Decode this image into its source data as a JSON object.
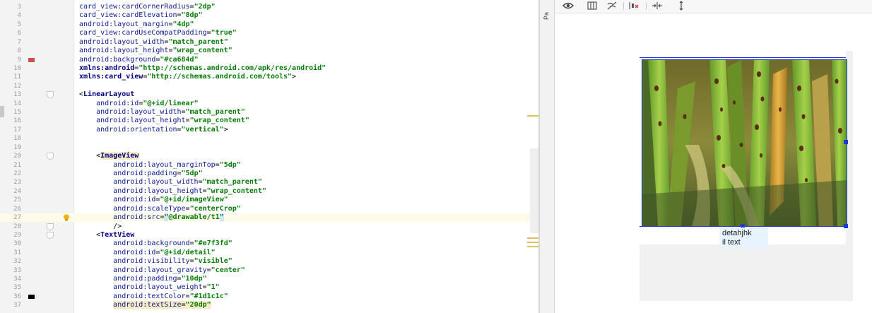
{
  "editor": {
    "lines": [
      {
        "n": "3",
        "html": "<span class=\"ns\">card_view:cardCornerRadius</span>=<span class=\"val\">\"2dp\"</span>"
      },
      {
        "n": "4",
        "html": "<span class=\"ns\">card_view:cardElevation</span>=<span class=\"val\">\"8dp\"</span>"
      },
      {
        "n": "5",
        "html": "<span class=\"attr\">android:layout_margin</span>=<span class=\"val\">\"4dp\"</span>"
      },
      {
        "n": "6",
        "html": "<span class=\"ns\">card_view:cardUseCompatPadding</span>=<span class=\"val\">\"true\"</span>"
      },
      {
        "n": "7",
        "html": "<span class=\"attr\">android:layout_width</span>=<span class=\"val\">\"match_parent\"</span>"
      },
      {
        "n": "8",
        "html": "<span class=\"attr\">android:layout_height</span>=<span class=\"val\">\"wrap_content\"</span>"
      },
      {
        "n": "9",
        "html": "<span class=\"attr\">android:background</span>=<span class=\"val\">\"#ca684d\"</span>",
        "mark": "red"
      },
      {
        "n": "10",
        "html": "<span class=\"tag\">xmlns:android</span>=<span class=\"val\">\"http://schemas.android.com/apk/res/android\"</span>"
      },
      {
        "n": "11",
        "html": "<span class=\"tag\">xmlns:card_view</span>=<span class=\"val\">\"http://schemas.android.com/tools\"</span>&gt;"
      },
      {
        "n": "12",
        "html": ""
      },
      {
        "n": "13",
        "html": "&lt;<span class=\"tag\">LinearLayout</span>",
        "fold": true
      },
      {
        "n": "14",
        "html": "    <span class=\"attr\">android:id</span>=<span class=\"val\">\"@+id/linear\"</span>"
      },
      {
        "n": "15",
        "html": "    <span class=\"attr\">android:layout_width</span>=<span class=\"val\">\"match_parent\"</span>"
      },
      {
        "n": "16",
        "html": "    <span class=\"attr\">android:layout_height</span>=<span class=\"val\">\"wrap_content\"</span>"
      },
      {
        "n": "17",
        "html": "    <span class=\"attr\">android:orientation</span>=<span class=\"val\">\"vertical\"</span>&gt;"
      },
      {
        "n": "18",
        "html": ""
      },
      {
        "n": "19",
        "html": ""
      },
      {
        "n": "20",
        "html": "    &lt;<span class=\"tag hl\">ImageView</span>",
        "fold": true
      },
      {
        "n": "21",
        "html": "        <span class=\"attr\">android:layout_marginTop</span>=<span class=\"val\">\"5dp\"</span>"
      },
      {
        "n": "22",
        "html": "        <span class=\"attr\">android:padding</span>=<span class=\"val\">\"5dp\"</span>"
      },
      {
        "n": "23",
        "html": "        <span class=\"attr\">android:layout_width</span>=<span class=\"val\">\"match_parent\"</span>"
      },
      {
        "n": "24",
        "html": "        <span class=\"attr\">android:layout_height</span>=<span class=\"val\">\"wrap_content\"</span>"
      },
      {
        "n": "25",
        "html": "        <span class=\"attr\">android:id</span>=<span class=\"val\">\"@+id/imageView\"</span>"
      },
      {
        "n": "26",
        "html": "        <span class=\"attr\">android:scaleType</span>=<span class=\"val\">\"centerCrop\"</span>"
      },
      {
        "n": "27",
        "html": "        <span class=\"attr\">android:src</span>=<span class=\"val\"><span class=\"sel\">\"</span>@drawable/t1<span class=\"sel\">\"</span></span>",
        "current": true,
        "bulb": true
      },
      {
        "n": "28",
        "html": "        /&gt;",
        "fold": true
      },
      {
        "n": "29",
        "html": "    &lt;<span class=\"tag\">TextView</span>",
        "fold": true
      },
      {
        "n": "30",
        "html": "        <span class=\"attr\">android:background</span>=<span class=\"val\">\"#e7f3fd\"</span>"
      },
      {
        "n": "31",
        "html": "        <span class=\"attr\">android:id</span>=<span class=\"val\">\"@+id/detail\"</span>"
      },
      {
        "n": "32",
        "html": "        <span class=\"attr\">android:visibility</span>=<span class=\"val\">\"visible\"</span>"
      },
      {
        "n": "33",
        "html": "        <span class=\"attr\">android:layout_gravity</span>=<span class=\"val\">\"center\"</span>"
      },
      {
        "n": "34",
        "html": "        <span class=\"attr\">android:padding</span>=<span class=\"val\">\"10dp\"</span>"
      },
      {
        "n": "35",
        "html": "        <span class=\"attr\">android:layout_weight</span>=<span class=\"val\">\"1\"</span>"
      },
      {
        "n": "36",
        "html": "        <span class=\"attr\">android:textColor</span>=<span class=\"val\">\"#1d1c1c\"</span>",
        "mark": "black"
      },
      {
        "n": "37",
        "html": "        <span class=\"attr hl\">android:textSize</span><span class=\"hl\">=</span><span class=\"val hl\">\"20dp\"</span>"
      }
    ]
  },
  "side_panel_label": "Pa",
  "design": {
    "textview_text_line1": "detahjhk",
    "textview_text_line2": "il text"
  },
  "colors": {
    "card_background": "#ca684d",
    "textview_background": "#e7f3fd",
    "text_color": "#1d1c1c",
    "selection": "#1d3ad6"
  }
}
